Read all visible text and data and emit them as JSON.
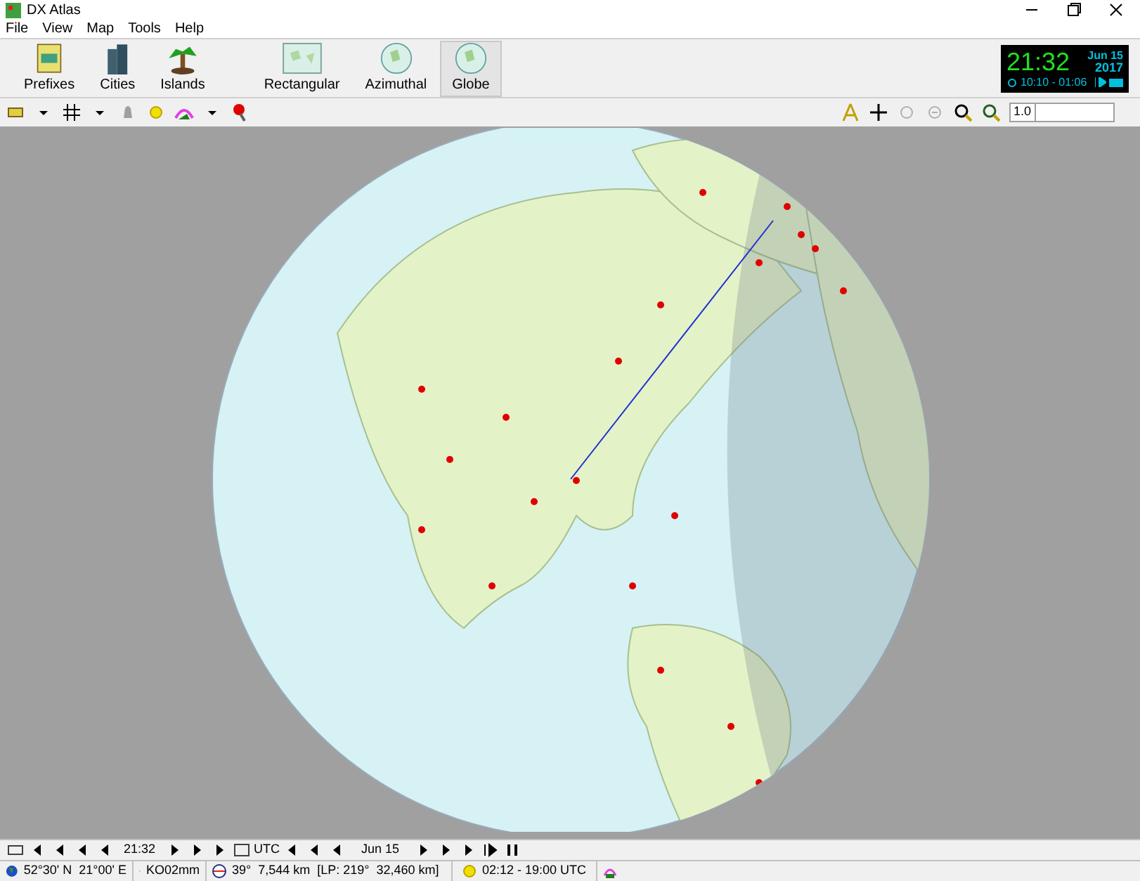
{
  "window": {
    "title": "DX Atlas"
  },
  "menu": [
    "File",
    "View",
    "Map",
    "Tools",
    "Help"
  ],
  "toolbar": [
    {
      "label": "Prefixes",
      "kind": "prefixes",
      "selected": false
    },
    {
      "label": "Cities",
      "kind": "cities",
      "selected": false
    },
    {
      "label": "Islands",
      "kind": "islands",
      "selected": false
    },
    {
      "label": "Rectangular",
      "kind": "rect",
      "selected": false
    },
    {
      "label": "Azimuthal",
      "kind": "azim",
      "selected": false
    },
    {
      "label": "Globe",
      "kind": "globe",
      "selected": true
    }
  ],
  "clock": {
    "time": "21:32",
    "date": "Jun 15",
    "year": "2017",
    "sun_times": "10:10 - 01:06"
  },
  "zoom_field": {
    "value": "1.0"
  },
  "time_bar": {
    "time": "21:32",
    "zone": "UTC",
    "date": "Jun 15"
  },
  "status_bar": {
    "position": "52°30' N  21°00' E",
    "locator": "KO02mm",
    "bearing": "39°  7,544 km  [LP: 219°  32,460 km]",
    "sun": "02:12 - 19:00 UTC"
  }
}
